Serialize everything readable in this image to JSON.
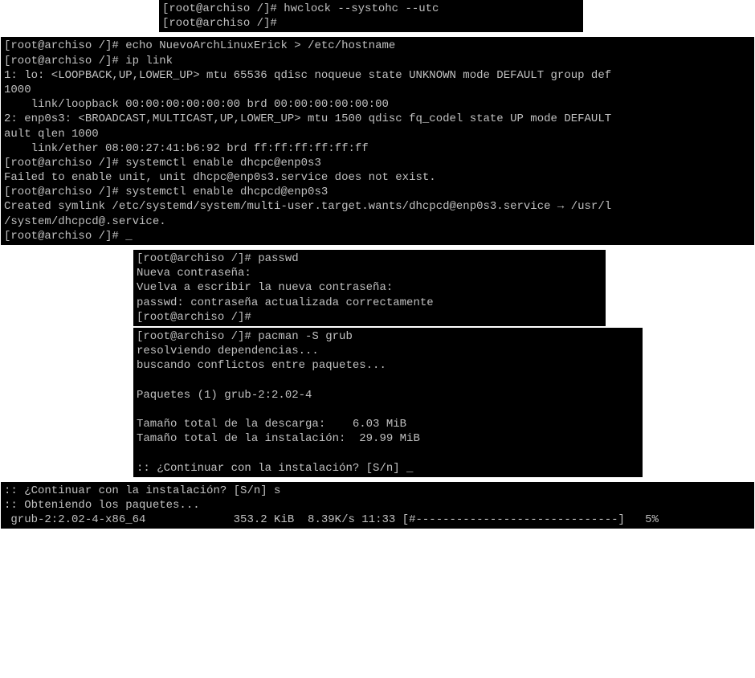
{
  "block1": {
    "line1": "[root@archiso /]# hwclock --systohc --utc",
    "line2": "[root@archiso /]#"
  },
  "block2": {
    "l1": "[root@archiso /]# echo NuevoArchLinuxErick > /etc/hostname",
    "l2": "[root@archiso /]# ip link",
    "l3": "1: lo: <LOOPBACK,UP,LOWER_UP> mtu 65536 qdisc noqueue state UNKNOWN mode DEFAULT group def",
    "l4": "1000",
    "l5": "    link/loopback 00:00:00:00:00:00 brd 00:00:00:00:00:00",
    "l6": "2: enp0s3: <BROADCAST,MULTICAST,UP,LOWER_UP> mtu 1500 qdisc fq_codel state UP mode DEFAULT",
    "l7": "ault qlen 1000",
    "l8": "    link/ether 08:00:27:41:b6:92 brd ff:ff:ff:ff:ff:ff",
    "l9": "[root@archiso /]# systemctl enable dhcpc@enp0s3",
    "l10": "Failed to enable unit, unit dhcpc@enp0s3.service does not exist.",
    "l11": "[root@archiso /]# systemctl enable dhcpcd@enp0s3",
    "l12": "Created symlink /etc/systemd/system/multi-user.target.wants/dhcpcd@enp0s3.service → /usr/l",
    "l13": "/system/dhcpcd@.service.",
    "l14": "[root@archiso /]# _"
  },
  "block3": {
    "l1": "[root@archiso /]# passwd",
    "l2": "Nueva contraseña:",
    "l3": "Vuelva a escribir la nueva contraseña:",
    "l4": "passwd: contraseña actualizada correctamente",
    "l5": "[root@archiso /]#"
  },
  "block4": {
    "l1": "[root@archiso /]# pacman -S grub",
    "l2": "resolviendo dependencias...",
    "l3": "buscando conflictos entre paquetes...",
    "l4": "",
    "l5": "Paquetes (1) grub-2:2.02-4",
    "l6": "",
    "l7": "Tamaño total de la descarga:    6.03 MiB",
    "l8": "Tamaño total de la instalación:  29.99 MiB",
    "l9": "",
    "l10": ":: ¿Continuar con la instalación? [S/n] _"
  },
  "block5": {
    "l1": ":: ¿Continuar con la instalación? [S/n] s",
    "l2": ":: Obteniendo los paquetes...",
    "l3": " grub-2:2.02-4-x86_64             353.2 KiB  8.39K/s 11:33 [#------------------------------]   5%"
  }
}
